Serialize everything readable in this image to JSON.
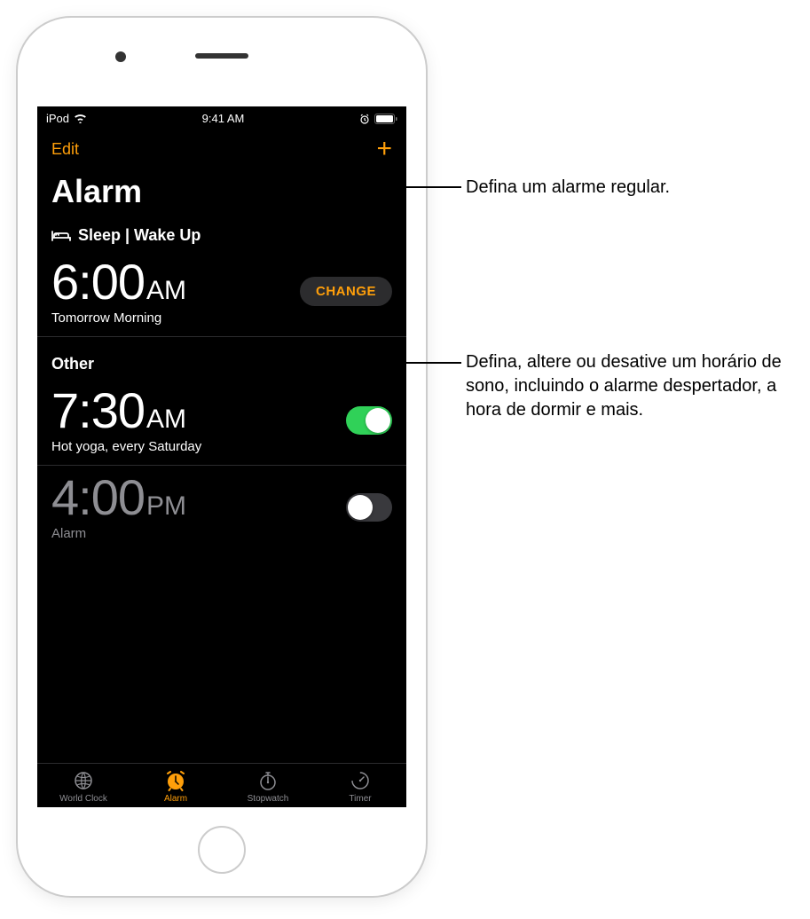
{
  "statusBar": {
    "carrier": "iPod",
    "time": "9:41 AM"
  },
  "nav": {
    "edit": "Edit",
    "add": "+"
  },
  "title": "Alarm",
  "sleepSection": {
    "label": "Sleep | Wake Up",
    "time": "6:00",
    "ampm": "AM",
    "subtitle": "Tomorrow Morning",
    "changeLabel": "CHANGE"
  },
  "otherSection": {
    "label": "Other",
    "alarms": [
      {
        "time": "7:30",
        "ampm": "AM",
        "subtitle": "Hot yoga, every Saturday",
        "enabled": true
      },
      {
        "time": "4:00",
        "ampm": "PM",
        "subtitle": "Alarm",
        "enabled": false
      }
    ]
  },
  "tabs": {
    "worldClock": "World Clock",
    "alarm": "Alarm",
    "stopwatch": "Stopwatch",
    "timer": "Timer"
  },
  "callouts": {
    "add": "Defina um alarme regular.",
    "change": "Defina, altere ou desative um horário de sono, incluindo o alarme despertador, a hora de dormir e mais."
  }
}
